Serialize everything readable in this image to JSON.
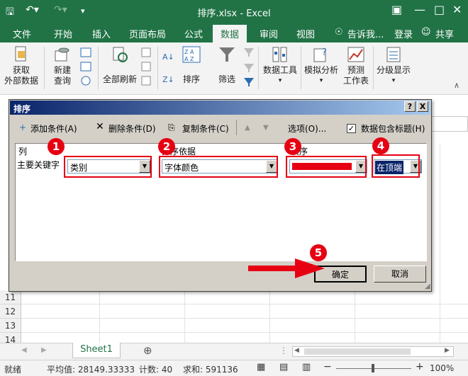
{
  "window": {
    "title": "排序.xlsx - Excel"
  },
  "tabs": [
    "文件",
    "开始",
    "插入",
    "页面布局",
    "公式",
    "数据",
    "审阅",
    "视图"
  ],
  "active_tab": "数据",
  "tellme": "告诉我...",
  "login": "登录",
  "share": "共享",
  "ribbon": {
    "get_data": [
      "获取",
      "外部数据"
    ],
    "new_query": [
      "新建",
      "查询"
    ],
    "refresh_all": "全部刷新",
    "sort": "排序",
    "filter": "筛选",
    "data_tools": "数据工具",
    "whatif": "模拟分析",
    "forecast": [
      "预测",
      "工作表"
    ],
    "outline": "分级显示"
  },
  "dialog": {
    "title": "排序",
    "help": "?",
    "close": "X",
    "add_level": "添加条件(A)",
    "delete_level": "删除条件(D)",
    "copy_level": "复制条件(C)",
    "options": "选项(O)...",
    "has_headers": "数据包含标题(H)",
    "col_header": "列",
    "sorton_header": "排序依据",
    "order_header": "次序",
    "row_label": "主要关键字",
    "column_value": "类别",
    "sorton_value": "字体颜色",
    "order_color": "#e60012",
    "position_value": "在顶端",
    "ok": "确定",
    "cancel": "取消"
  },
  "badges": [
    "1",
    "2",
    "3",
    "4",
    "5"
  ],
  "rows": [
    "11",
    "12",
    "13",
    "14"
  ],
  "sheet_tab": "Sheet1",
  "status": {
    "ready": "就绪",
    "average": "平均值: 28149.33333",
    "count": "计数: 40",
    "sum": "求和: 591136",
    "zoom": "100%"
  },
  "colors": {
    "excel_green": "#217346",
    "annotation_red": "#e60012"
  }
}
